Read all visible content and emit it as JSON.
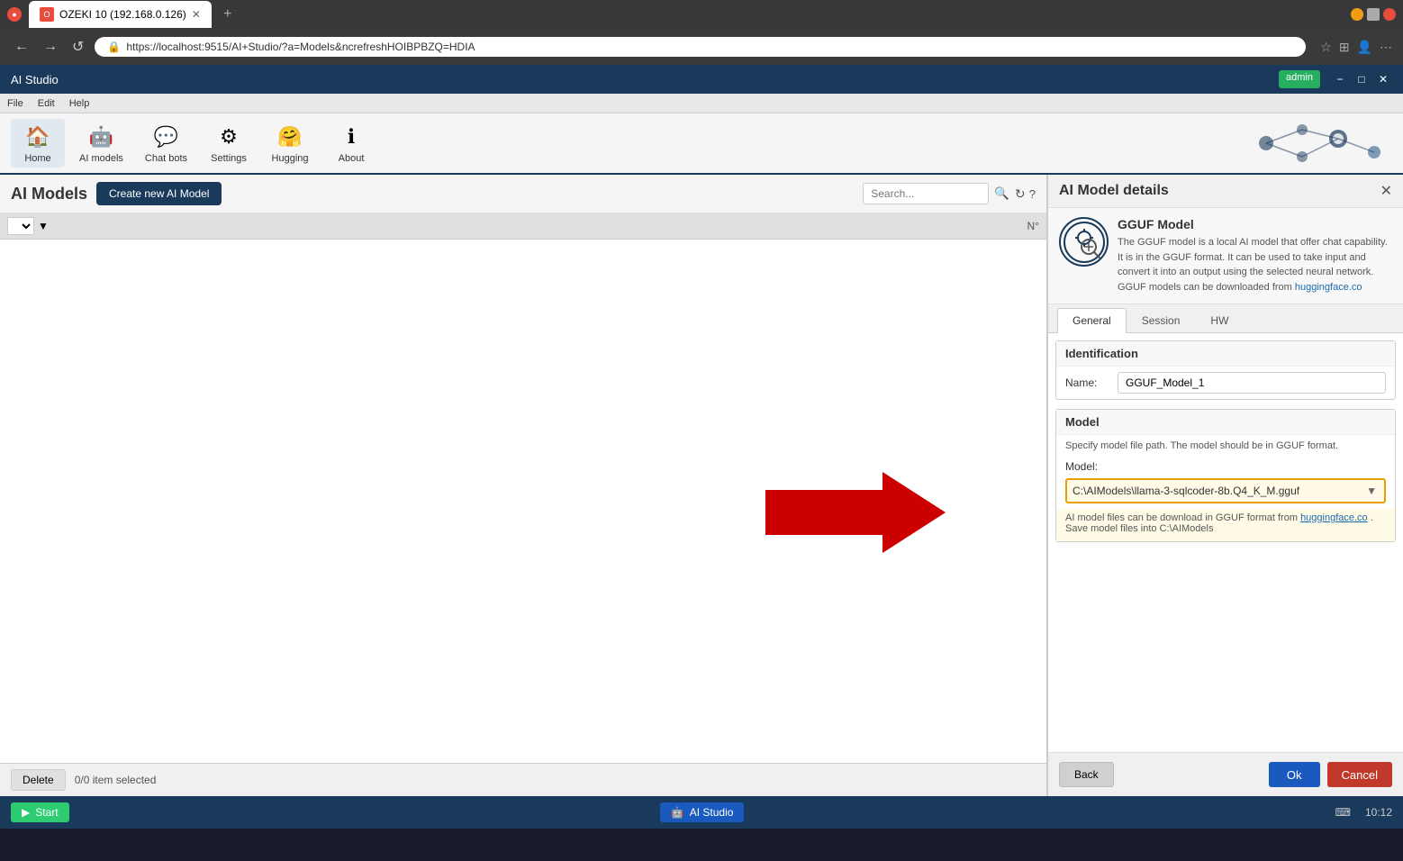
{
  "browser": {
    "tab_title": "OZEKI 10 (192.168.0.126)",
    "url": "https://localhost:9515/AI+Studio/?a=Models&ncrefreshHOIBPBZQ=HDIA",
    "new_tab_label": "+",
    "nav_back": "←",
    "nav_forward": "→",
    "nav_refresh": "↺"
  },
  "app": {
    "title": "AI Studio",
    "user": "admin",
    "menu": {
      "file": "File",
      "edit": "Edit",
      "help": "Help"
    }
  },
  "toolbar": {
    "home_label": "Home",
    "ai_models_label": "AI models",
    "chat_bots_label": "Chat bots",
    "settings_label": "Settings",
    "hugging_label": "Hugging",
    "about_label": "About"
  },
  "left_panel": {
    "page_title": "AI Models",
    "create_btn_label": "Create new AI Model",
    "search_placeholder": "Search...",
    "col_header": "N°",
    "delete_btn": "Delete",
    "selection_info": "0/0 item selected"
  },
  "right_panel": {
    "title": "AI Model details",
    "model_name": "GGUF Model",
    "model_desc": "The GGUF model is a local AI model that offer chat capability. It is in the GGUF format. It can be used to take input and convert it into an output using the selected neural network. GGUF models can be downloaded from",
    "model_link_text": "huggingface.co",
    "model_link_href": "huggingface.co",
    "tabs": {
      "general": "General",
      "session": "Session",
      "hw": "HW"
    },
    "identification": {
      "section_title": "Identification",
      "name_label": "Name:",
      "name_value": "GGUF_Model_1"
    },
    "model_section": {
      "section_title": "Model",
      "path_desc": "Specify model file path. The model should be in GGUF format.",
      "model_label": "Model:",
      "model_value": "C:\\AIModels\\llama-3-sqlcoder-8b.Q4_K_M.gguf",
      "download_note": "AI model files can be download in GGUF format from",
      "download_link": "huggingface.co",
      "download_note2": ". Save model files into C:\\AIModels"
    },
    "buttons": {
      "back": "Back",
      "ok": "Ok",
      "cancel": "Cancel"
    }
  },
  "status_bar": {
    "start_label": "Start",
    "ai_studio_label": "AI Studio",
    "time": "10:12"
  }
}
